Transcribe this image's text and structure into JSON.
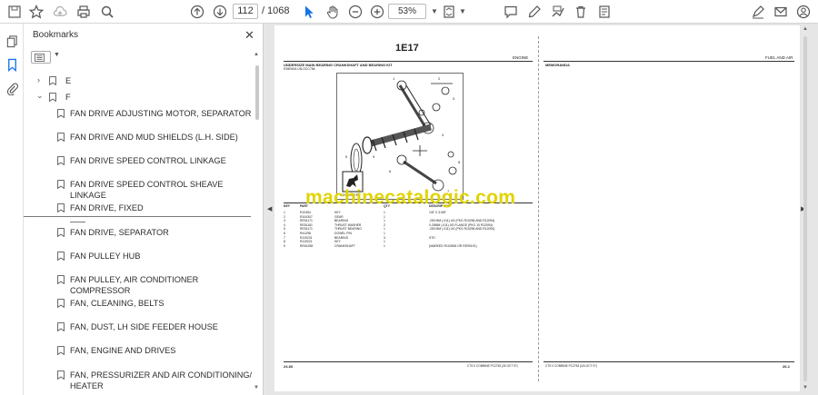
{
  "toolbar": {
    "page_current": "112",
    "page_separator": "/",
    "page_total": "1068",
    "zoom_value": "53%"
  },
  "bookmarks_panel": {
    "title": "Bookmarks",
    "items": [
      {
        "label": "E",
        "level": 0,
        "expanded": false
      },
      {
        "label": "F",
        "level": 0,
        "expanded": true
      },
      {
        "label": "FAN DRIVE ADJUSTING MOTOR, SEPARATOR",
        "level": 1
      },
      {
        "label": "FAN DRIVE AND MUD SHIELDS (L.H. SIDE)",
        "level": 1
      },
      {
        "label": "FAN DRIVE SPEED CONTROL LINKAGE",
        "level": 1
      },
      {
        "label": "FAN DRIVE SPEED CONTROL SHEAVE LINKAGE",
        "level": 1
      },
      {
        "label": "FAN DRIVE, FIXED",
        "level": 1
      },
      {
        "label": "FAN DRIVE, SEPARATOR",
        "level": 1
      },
      {
        "label": "FAN PULLEY HUB",
        "level": 1
      },
      {
        "label": "FAN PULLEY, AIR CONDITIONER COMPRESSOR",
        "level": 1
      },
      {
        "label": "FAN, CLEANING, BELTS",
        "level": 1
      },
      {
        "label": "FAN, DUST, LH SIDE FEEDER HOUSE",
        "level": 1
      },
      {
        "label": "FAN, ENGINE AND DRIVES",
        "level": 1
      },
      {
        "label": "FAN, PRESSURIZER AND AIR CONDITIONING/",
        "level": 1,
        "label2": "HEATER"
      }
    ]
  },
  "document": {
    "page_code": "1E17",
    "left_header_right": "ENGINE",
    "right_header_right": "FUEL AND AIR",
    "left_title": "UNDERSIZE MAIN BEARING CRANKSHAFT AND BEARING KIT",
    "left_subtitle": "R35R406          UN-OCC756",
    "right_title": "MEMORANDA",
    "brand": "JOHN DEERE",
    "table_header": [
      "KEY",
      "PART",
      "",
      "QTY",
      "DESCRIPTION"
    ],
    "table_rows": [
      [
        "1",
        "R10454",
        "KEY",
        "1",
        "1/8\" X 3-5/8\""
      ],
      [
        "2",
        "R104307",
        "GEAR",
        "1",
        ""
      ],
      [
        "3",
        "RE51171",
        "BEARING",
        "1",
        ".250 MM (.011) US (PKG R10296 AND R12094)"
      ],
      [
        "4",
        "RE51181",
        "THRUST WASHER",
        "2",
        "0.25MM (.011) US FLANGE (PKG 10 R12094)"
      ],
      [
        "5",
        "RE51171",
        "THRUST BEARING",
        "1",
        ".250 MM (.011) US (PKG R10296 AND R12094)"
      ],
      [
        "6",
        "R41298",
        "DOWEL PIN",
        "1",
        ""
      ],
      [
        "7",
        "R119231",
        "BEARING",
        "3",
        "STD"
      ],
      [
        "8",
        "R119221",
        "KEY",
        "1",
        ""
      ],
      [
        "9",
        "RE61258",
        "CRANKSHAFT",
        "1",
        "(MARKED R102854 OR RE99191)"
      ]
    ],
    "watermark": "machinecatalogic.com",
    "footer_left_page": "24-66",
    "footer_left_mid": "CTS II COMBINE  PC2763    (30 OCT 97)",
    "footer_right_mid": "CTS II COMBINE  PC2763    (UN-OCT 97)",
    "footer_right_page": "26-1"
  },
  "colors": {
    "watermark": "#e0d400",
    "accent": "#1473e6",
    "toolbar_bg": "#ffffff",
    "viewer_bg": "#e6e6e6"
  }
}
